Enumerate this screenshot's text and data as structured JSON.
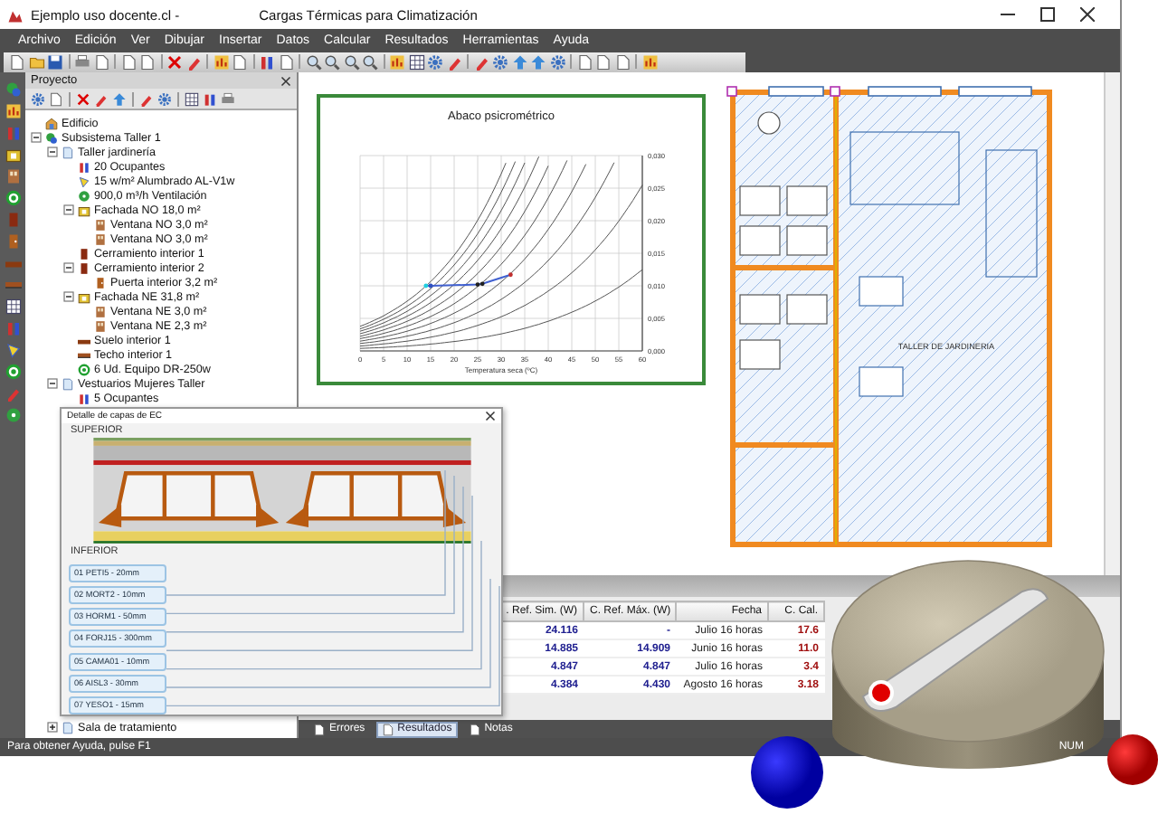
{
  "window": {
    "file_title": "Ejemplo uso docente.cl -",
    "app_title": "Cargas Térmicas para Climatización"
  },
  "menu": [
    "Archivo",
    "Edición",
    "Ver",
    "Dibujar",
    "Insertar",
    "Datos",
    "Calcular",
    "Resultados",
    "Herramientas",
    "Ayuda"
  ],
  "project_panel": {
    "title": "Proyecto",
    "tree": [
      {
        "label": "Edificio",
        "kind": "building"
      },
      {
        "label": "Subsistema Taller 1",
        "kind": "system",
        "expanded": true,
        "children": [
          {
            "label": "Taller jardinería",
            "kind": "space",
            "expanded": true,
            "children": [
              {
                "label": "20 Ocupantes",
                "kind": "people"
              },
              {
                "label": "15 w/m² Alumbrado AL-V1w",
                "kind": "light"
              },
              {
                "label": "900,0 m³/h Ventilación",
                "kind": "fan"
              },
              {
                "label": "Fachada NO 18,0 m²",
                "kind": "facade",
                "expanded": true,
                "children": [
                  {
                    "label": "Ventana NO 3,0 m²",
                    "kind": "window"
                  },
                  {
                    "label": "Ventana NO 3,0 m²",
                    "kind": "window"
                  }
                ]
              },
              {
                "label": "Cerramiento interior 1",
                "kind": "wall"
              },
              {
                "label": "Cerramiento interior 2",
                "kind": "wall",
                "expanded": true,
                "children": [
                  {
                    "label": "Puerta interior 3,2 m²",
                    "kind": "door"
                  }
                ]
              },
              {
                "label": "Fachada NE 31,8 m²",
                "kind": "facade",
                "expanded": true,
                "children": [
                  {
                    "label": "Ventana NE 3,0 m²",
                    "kind": "window"
                  },
                  {
                    "label": "Ventana NE 2,3 m²",
                    "kind": "window"
                  }
                ]
              },
              {
                "label": "Suelo interior 1",
                "kind": "floor"
              },
              {
                "label": "Techo interior 1",
                "kind": "ceiling"
              },
              {
                "label": "6 Ud. Equipo DR-250w",
                "kind": "equipment"
              }
            ]
          },
          {
            "label": "Vestuarios Mujeres Taller",
            "kind": "space",
            "expanded": true,
            "children": [
              {
                "label": "5 Ocupantes",
                "kind": "people"
              }
            ]
          },
          {
            "label": "Sala de tratamiento",
            "kind": "space",
            "expanded": false
          }
        ]
      }
    ]
  },
  "chart_window": {
    "chart_data": {
      "type": "line",
      "grid": true,
      "title": "Abaco psicrométrico",
      "xlabel": "Temperatura seca (ºC)",
      "x": [
        14,
        15,
        25,
        26,
        32
      ],
      "values": [
        0.01,
        0.01,
        0.0102,
        0.0103,
        0.0117
      ],
      "xlim": [
        0,
        60
      ],
      "ylim": [
        0,
        0.03
      ],
      "xticks": [
        0,
        5,
        10,
        15,
        20,
        25,
        30,
        35,
        40,
        45,
        50,
        55,
        60
      ],
      "yticks": [
        {
          "value": 0,
          "label": "0,000"
        },
        {
          "value": 0.005,
          "label": "0,005"
        },
        {
          "value": 0.01,
          "label": "0,010"
        },
        {
          "value": 0.015,
          "label": "0,015"
        },
        {
          "value": 0.02,
          "label": "0,020"
        },
        {
          "value": 0.025,
          "label": "0,025"
        },
        {
          "value": 0.03,
          "label": "0,030"
        }
      ]
    }
  },
  "floor_plan": {
    "room_label": "TALLER DE JARDINERIA"
  },
  "layer_window": {
    "title": "Detalle de capas de EC",
    "top_label": "SUPERIOR",
    "bottom_label": "INFERIOR",
    "layers": [
      "01 PETI5 - 20mm",
      "02 MORT2 - 10mm",
      "03 HORM1 - 50mm",
      "04 FORJ15 - 300mm",
      "05 CAMA01 - 10mm",
      "06 AISL3 - 30mm",
      "07 YESO1 - 15mm"
    ]
  },
  "results_table": {
    "columns": [
      ". Ref. Sim. (W)",
      "C. Ref. Máx. (W)",
      "Fecha",
      "C. Cal."
    ],
    "rows": [
      [
        "24.116",
        "-",
        "Julio 16 horas",
        "17.6"
      ],
      [
        "14.885",
        "14.909",
        "Junio 16 horas",
        "11.0"
      ],
      [
        "4.847",
        "4.847",
        "Julio 16 horas",
        "3.4"
      ],
      [
        "4.384",
        "4.430",
        "Agosto 16 horas",
        "3.18"
      ]
    ]
  },
  "bottom_tabs": [
    {
      "label": "Errores",
      "selected": false
    },
    {
      "label": "Resultados",
      "selected": true
    },
    {
      "label": "Notas",
      "selected": false
    }
  ],
  "status_bar": {
    "message": "Para obtener Ayuda, pulse F1",
    "indicator": "NUM"
  }
}
